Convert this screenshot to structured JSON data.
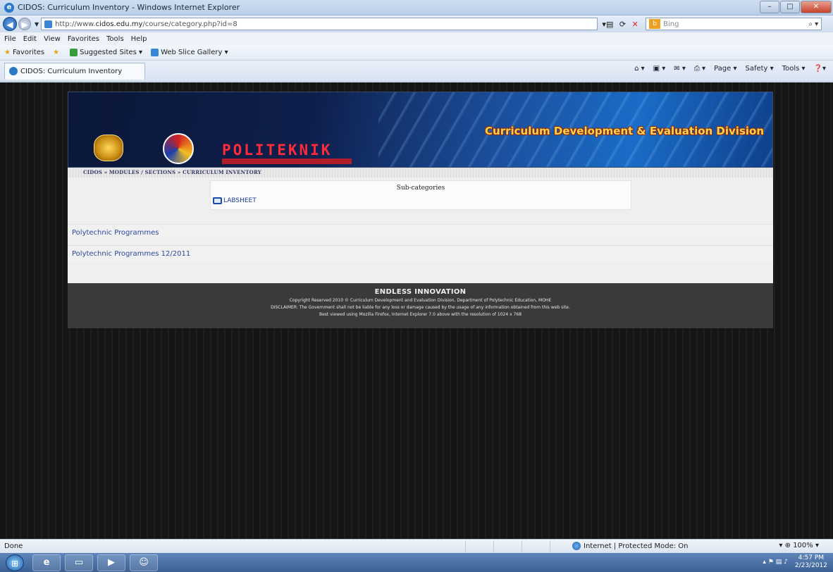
{
  "window": {
    "title": "CIDOS: Curriculum Inventory - Windows Internet Explorer",
    "min": "–",
    "max": "□",
    "close": "✕"
  },
  "address": {
    "url_prefix": "http://www.",
    "url_domain": "cidos.edu.my",
    "url_path": "/course/category.php?id=8",
    "search_placeholder": "Bing"
  },
  "menu": [
    "File",
    "Edit",
    "View",
    "Favorites",
    "Tools",
    "Help"
  ],
  "favorites": {
    "label": "Favorites",
    "items": [
      "Suggested Sites ▾",
      "Web Slice Gallery ▾"
    ]
  },
  "tab": {
    "label": "CIDOS: Curriculum Inventory"
  },
  "commandbar": [
    "Page ▾",
    "Safety ▾",
    "Tools ▾"
  ],
  "site": {
    "division": "Curriculum Development & Evaluation Division",
    "brand": "POLITEKNIK",
    "breadcrumbs": "CIDOS » MODULES / SECTIONS » CURRICULUM INVENTORY",
    "subcategories_header": "Sub-categories",
    "subcategory_link": "LABSHEET",
    "programmes": [
      {
        "label": "Polytechnic Programmes"
      },
      {
        "label": "Polytechnic Programmes 12/2011"
      }
    ],
    "footer": {
      "title": "ENDLESS INNOVATION",
      "copyright": "Copyright Reserved 2010 © Curriculum Development and Evaluation Division, Department of Polytechnic Education, MOHE",
      "disclaimer": "DISCLAIMER: The Government shall not be liable for any loss or damage caused by the usage of any information obtained from this web site.",
      "best_viewed": "Best viewed using Mozilla Firefox, Internet Explorer 7.0 above with the resolution of 1024 x 768"
    }
  },
  "status": {
    "left": "Done",
    "zone": "Internet | Protected Mode: On",
    "zoom": "100%"
  },
  "taskbar": {
    "time": "4:57 PM",
    "date": "2/23/2012"
  }
}
